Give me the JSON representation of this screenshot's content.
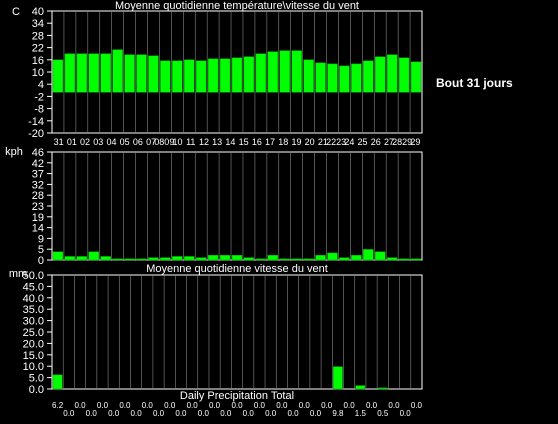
{
  "side_label": "Bout 31 jours",
  "colors": {
    "background": "#000000",
    "bar": "#00ff00",
    "grid": "#ffffff",
    "text": "#ffffff"
  },
  "chart_data": [
    {
      "type": "bar",
      "title": "Moyenne quotidienne température\\vitesse du vent",
      "unit": "C",
      "ylim": [
        -20,
        40
      ],
      "yticks": [
        "40",
        "34",
        "28",
        "22",
        "16",
        "10",
        "4",
        "-2",
        "-8",
        "-14",
        "-20"
      ],
      "categories": [
        "31",
        "01",
        "02",
        "03",
        "04",
        "05",
        "06",
        "07",
        "08",
        "09",
        "10",
        "11",
        "12",
        "13",
        "14",
        "15",
        "16",
        "17",
        "18",
        "19",
        "20",
        "21",
        "22",
        "23",
        "24",
        "25",
        "26",
        "27",
        "28",
        "29",
        "29"
      ],
      "x_tick_labels": [
        "31",
        "01",
        "02",
        "03",
        "04",
        "05",
        "06",
        "07",
        "0809",
        "10",
        "11",
        "12",
        "13",
        "14",
        "15",
        "16",
        "17",
        "18",
        "19",
        "20",
        "21",
        "2223",
        "24",
        "25",
        "26",
        "27",
        "2829",
        "29"
      ],
      "values": [
        16,
        19,
        19,
        19,
        19,
        21,
        18.5,
        18.5,
        18,
        15.5,
        15.5,
        16,
        15.5,
        16.5,
        16.5,
        17,
        17.5,
        19,
        20,
        20.5,
        20.5,
        16,
        14.5,
        14,
        13,
        14,
        15.5,
        17.5,
        18.5,
        17,
        15
      ]
    },
    {
      "type": "bar",
      "title": "",
      "unit": "kph",
      "ylim": [
        0,
        46
      ],
      "yticks": [
        "46",
        "42",
        "37",
        "32",
        "28",
        "23",
        "19",
        "14",
        "9",
        "5",
        "0"
      ],
      "values": [
        3.5,
        1.5,
        1.5,
        3.5,
        1.5,
        0.5,
        0.5,
        0.5,
        1,
        1,
        1.5,
        1.5,
        1,
        2,
        2,
        2,
        1,
        0.5,
        2,
        0.5,
        0.5,
        0.5,
        2,
        3,
        1,
        2,
        4.5,
        3.5,
        1,
        0.5,
        0.5
      ]
    },
    {
      "type": "bar",
      "title": "Moyenne quotidienne vitesse du vent",
      "xlabel": "Daily Precipitation Total",
      "unit": "mm",
      "ylim": [
        0,
        50
      ],
      "yticks": [
        "50.0",
        "45.0",
        "40.0",
        "35.0",
        "30.0",
        "25.0",
        "20.0",
        "15.0",
        "10.0",
        "5.0",
        "0.0"
      ],
      "values": [
        6.2,
        0,
        0,
        0,
        0,
        0,
        0,
        0,
        0,
        0,
        0,
        0,
        0,
        0,
        0,
        0,
        0,
        0,
        0,
        0,
        0,
        0,
        0,
        0,
        0,
        9.8,
        0,
        1.5,
        0,
        0.5,
        0,
        0,
        0
      ],
      "value_labels": [
        "6.2",
        "0.0",
        "0.0",
        "0.0",
        "0.0",
        "0.0",
        "0.0",
        "0.0",
        "0.0",
        "0.0",
        "0.0",
        "0.0",
        "0.0",
        "0.0",
        "0.0",
        "0.0",
        "0.0",
        "0.0",
        "0.0",
        "0.0",
        "0.0",
        "0.0",
        "0.0",
        "0.0",
        "0.0",
        "9.8",
        "0.0",
        "1.5",
        "0.0",
        "0.5",
        "0.0",
        "0.0",
        "0.0"
      ]
    }
  ]
}
